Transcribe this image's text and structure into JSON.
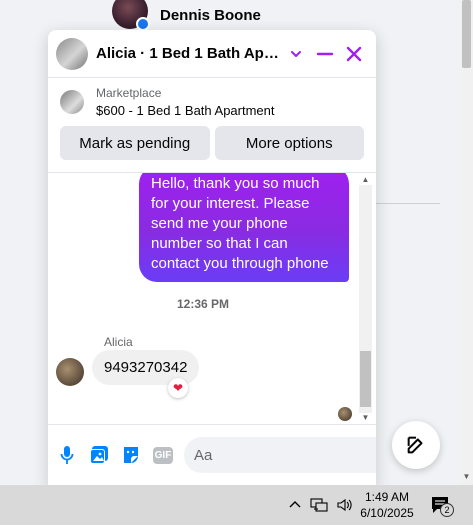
{
  "background": {
    "contact_name": "Dennis Boone"
  },
  "chat": {
    "title": "Alicia · 1 Bed 1 Bath Apart...",
    "header_icons": [
      "chevron-down-icon",
      "minimize-icon",
      "close-icon"
    ],
    "listing": {
      "label": "Marketplace",
      "title": "$600 - 1 Bed 1 Bath Apartment"
    },
    "actions": {
      "mark_pending": "Mark as pending",
      "more_options": "More options"
    },
    "messages": {
      "outgoing_text": "Hello, thank you so much for your interest. Please send me your phone number so that I can contact you through phone",
      "timestamp": "12:36 PM",
      "sender": "Alicia",
      "incoming_text": "9493270342",
      "reaction": "❤"
    },
    "composer": {
      "placeholder": "Aa",
      "gif_label": "GIF",
      "icons": [
        "microphone-icon",
        "photo-icon",
        "sticker-icon",
        "gif-icon",
        "emoji-icon",
        "thumbs-up-icon"
      ]
    }
  },
  "taskbar": {
    "time": "1:49 AM",
    "date": "6/10/2025",
    "notification_count": "2"
  },
  "colors": {
    "accent": "#a020f0",
    "bubble_gradient_end": "#6a3df5",
    "like_blue": "#0084ff"
  }
}
